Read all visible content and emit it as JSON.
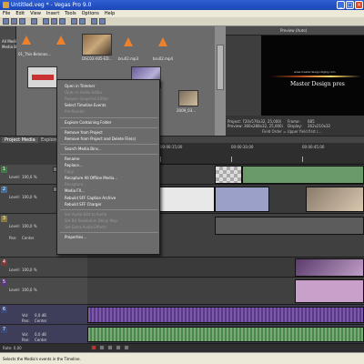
{
  "title": "Untitled.veg * - Vegas Pro 9.0",
  "menu": [
    "File",
    "Edit",
    "View",
    "Insert",
    "Tools",
    "Options",
    "Help"
  ],
  "tree": [
    "All Media",
    "Media Bins"
  ],
  "media": [
    {
      "label": "01_This-Belonas...",
      "kind": "cone"
    },
    {
      "label": "",
      "kind": "cone"
    },
    {
      "label": "DSC02-005-ED...",
      "kind": "clip"
    },
    {
      "label": "bru02.mp3",
      "kind": "cone"
    },
    {
      "label": "bru02.mp4",
      "kind": "cone"
    },
    {
      "label": "2009_02...",
      "kind": "clip"
    },
    {
      "label": "2009_03...",
      "kind": "clip"
    }
  ],
  "preview": {
    "mode": "Preview (Auto)",
    "line1": "www.masterdesign-bigtig.com",
    "line2": "Master Design pres",
    "project": "Project:  720x576x32, 25,000i",
    "preview_res": "Preview:  360x288x32, 25,000i",
    "frame_label": "Frame:",
    "frame": "685",
    "display_label": "Display:",
    "display": "262x210x32",
    "field_order": "Field Order = Upper field first (..."
  },
  "tabs": [
    "Project Media",
    "Explorer"
  ],
  "ruler": [
    "00:00:00;00",
    "00:00:15;00",
    "00:00:30;00",
    "00:00:45;00"
  ],
  "tracks": [
    {
      "num": "1",
      "level_label": "Level:",
      "level": "100,0 %",
      "color": "#3f7a3f"
    },
    {
      "num": "2",
      "level_label": "Level:",
      "level": "100,0 %",
      "color": "#3f6f9a"
    },
    {
      "num": "3",
      "level_label": "Level:",
      "level": "100,0 %",
      "pan_label": "Pan:",
      "pan": "Center",
      "color": "#8a7a3a"
    },
    {
      "num": "4",
      "level_label": "Level:",
      "level": "100,0 %",
      "color": "#7a3a3a"
    },
    {
      "num": "5",
      "level_label": "Level:",
      "level": "100,0 %",
      "color": "#5a3a7a"
    },
    {
      "num": "6",
      "level_label": "Vol:",
      "level": "0,0 dB",
      "pan_label": "Pan:",
      "pan": "Center",
      "color": "#3a4a7a"
    },
    {
      "num": "7",
      "level_label": "Vol:",
      "level": "0,0 dB",
      "pan_label": "Pan:",
      "pan": "Center",
      "color": "#3a4a7a"
    }
  ],
  "context_menu": [
    {
      "label": "Open in Trimmer",
      "enabled": true
    },
    {
      "label": "Open in Audio Editor",
      "enabled": false
    },
    {
      "label": "Reopen Snapshot Editor",
      "enabled": false
    },
    {
      "label": "Select Timeline Events",
      "enabled": true
    },
    {
      "label": "Pre-Render",
      "enabled": false
    },
    {
      "sep": true
    },
    {
      "label": "Explore Containing Folder",
      "enabled": true
    },
    {
      "sep": true
    },
    {
      "label": "Remove from Project",
      "enabled": true
    },
    {
      "label": "Remove from Project and Delete File(s)",
      "enabled": true
    },
    {
      "sep": true
    },
    {
      "label": "Search Media Bins...",
      "enabled": true
    },
    {
      "sep": true
    },
    {
      "label": "Rename",
      "enabled": true
    },
    {
      "label": "Replace...",
      "enabled": true
    },
    {
      "label": "Copy",
      "enabled": false
    },
    {
      "label": "Recapture All Offline Media...",
      "enabled": true
    },
    {
      "label": "Recapture...",
      "enabled": false
    },
    {
      "label": "Media FX...",
      "enabled": true
    },
    {
      "label": "Rebuild SFF Caption Archive",
      "enabled": true
    },
    {
      "label": "Rebuild SFF Charger",
      "enabled": true
    },
    {
      "sep": true
    },
    {
      "label": "Set Audio Edit to Audio",
      "enabled": false
    },
    {
      "label": "Set Bit Resolution Delay Map",
      "enabled": false
    },
    {
      "label": "Set Extra Audio Effects",
      "enabled": false
    },
    {
      "sep": true
    },
    {
      "label": "Properties...",
      "enabled": true
    }
  ],
  "rate": "Rate: 0,00",
  "status": "Selects the Media's events in the Timeline."
}
